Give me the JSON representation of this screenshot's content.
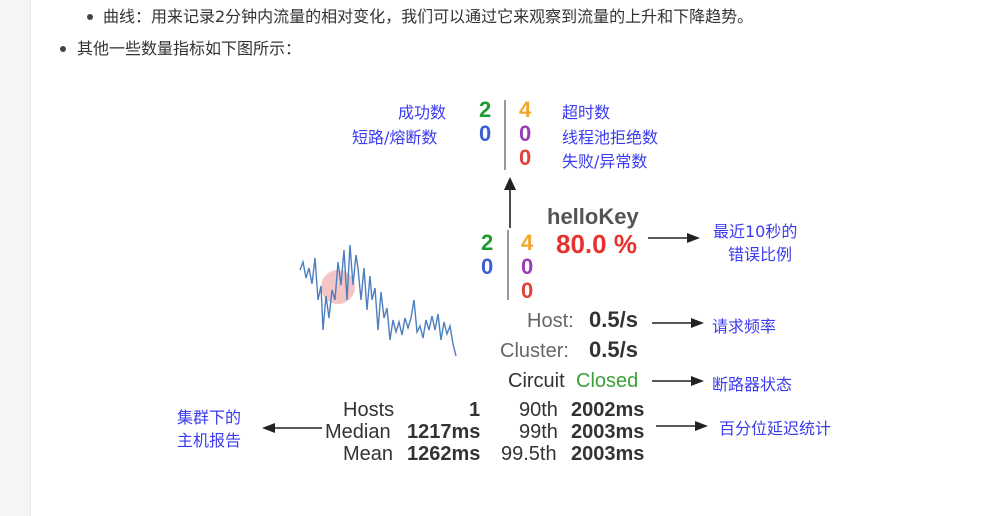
{
  "bullets": [
    {
      "text": "曲线：用来记录2分钟内流量的相对变化，我们可以通过它来观察到流量的上升和下降趋势。"
    },
    {
      "text": "其他一些数量指标如下图所示："
    }
  ],
  "legend": {
    "success_label": "成功数",
    "success_count": "2",
    "shortcircuit_label": "短路/熔断数",
    "shortcircuit_count": "0",
    "timeout_count": "4",
    "timeout_label": "超时数",
    "threadpool_count": "0",
    "threadpool_label": "线程池拒绝数",
    "failure_count": "0",
    "failure_label": "失败/异常数"
  },
  "panel": {
    "command_name": "helloKey",
    "success": "2",
    "shortcircuit": "0",
    "timeout": "4",
    "threadpool": "0",
    "failure": "0",
    "error_percent": "80.0 %",
    "host_label": "Host:",
    "host_rate": "0.5/s",
    "cluster_label": "Cluster:",
    "cluster_rate": "0.5/s",
    "circuit_label": "Circuit",
    "circuit_status": "Closed",
    "hosts_label": "Hosts",
    "hosts_value": "1",
    "median_label": "Median",
    "median_value": "1217ms",
    "mean_label": "Mean",
    "mean_value": "1262ms",
    "p90_label": "90th",
    "p90_value": "2002ms",
    "p99_label": "99th",
    "p99_value": "2003ms",
    "p995_label": "99.5th",
    "p995_value": "2003ms"
  },
  "annotations": {
    "error_ratio_line1": "最近10秒的",
    "error_ratio_line2": "错误比例",
    "request_rate": "请求频率",
    "circuit_state": "断路器状态",
    "percentile": "百分位延迟统计",
    "cluster_report_line1": "集群下的",
    "cluster_report_line2": "主机报告"
  },
  "colors": {
    "success": "#1d9a2f",
    "shortcircuit": "#3b5fcf",
    "timeout": "#f0a830",
    "threadpool": "#9a3bb8",
    "failure": "#e0413a",
    "error_percent": "#e8312c",
    "closed": "#3aa13a",
    "annotation": "#3b3bf0"
  }
}
